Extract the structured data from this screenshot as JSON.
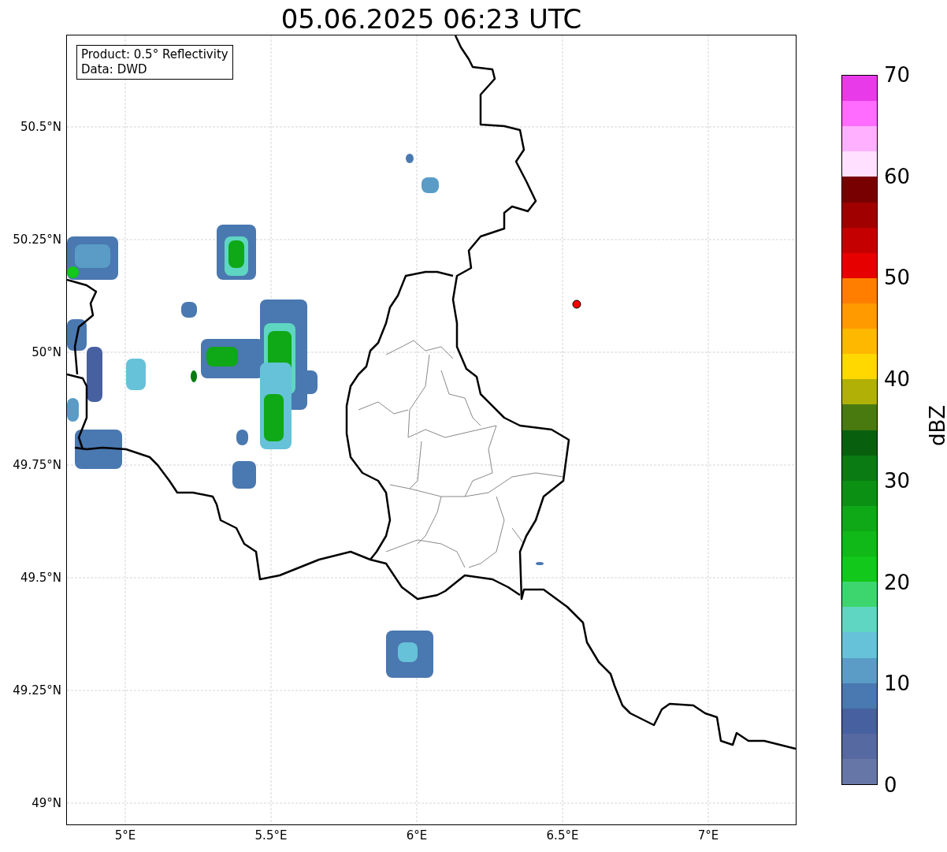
{
  "title": "05.06.2025 06:23 UTC",
  "info_box": {
    "lines": [
      "Product: 0.5° Reflectivity",
      "Data: DWD"
    ]
  },
  "map": {
    "lat_ticks": [
      "50.5°N",
      "50.25°N",
      "50°N",
      "49.75°N",
      "49.5°N",
      "49.25°N",
      "49°N"
    ],
    "lon_ticks": [
      "5°E",
      "5.5°E",
      "6°E",
      "6.5°E",
      "7°E"
    ]
  },
  "colorbar": {
    "label": "dBZ",
    "ticks": [
      "70",
      "60",
      "50",
      "40",
      "30",
      "20",
      "10",
      "0"
    ],
    "bins": [
      {
        "color": "#e83ae8"
      },
      {
        "color": "#ff6cff"
      },
      {
        "color": "#ffb0ff"
      },
      {
        "color": "#ffe0ff"
      },
      {
        "color": "#780000"
      },
      {
        "color": "#a00000"
      },
      {
        "color": "#c40000"
      },
      {
        "color": "#e60000"
      },
      {
        "color": "#ff7e00"
      },
      {
        "color": "#ff9a00"
      },
      {
        "color": "#ffb800"
      },
      {
        "color": "#ffd800"
      },
      {
        "color": "#b0b006"
      },
      {
        "color": "#487a10"
      },
      {
        "color": "#08600e"
      },
      {
        "color": "#0a7a12"
      },
      {
        "color": "#0c9014"
      },
      {
        "color": "#0fa816"
      },
      {
        "color": "#10b818"
      },
      {
        "color": "#12c81a"
      },
      {
        "color": "#3dd66e"
      },
      {
        "color": "#5fd6c2"
      },
      {
        "color": "#66c2d8"
      },
      {
        "color": "#5a9cc6"
      },
      {
        "color": "#4a78b0"
      },
      {
        "color": "#4660a0"
      },
      {
        "color": "#5669a0"
      },
      {
        "color": "#6676a6"
      }
    ]
  }
}
